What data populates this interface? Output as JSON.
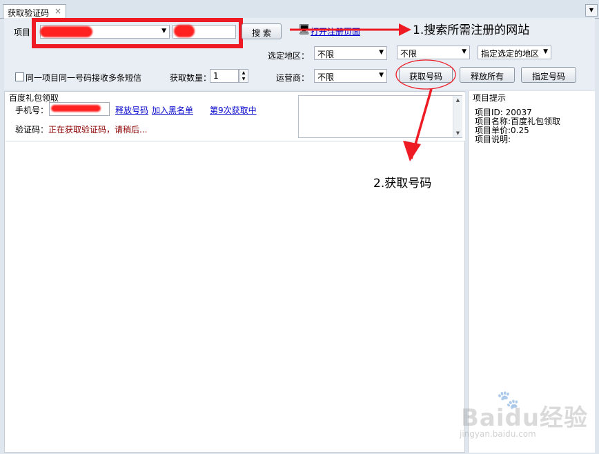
{
  "tab": {
    "title": "获取验证码",
    "close": "×"
  },
  "toolbar": {
    "project_label": "项目",
    "search_button": "搜 索",
    "open_register_link": "打开注册页面",
    "region_label": "选定地区：",
    "region_province": "不限",
    "region_city": "不限",
    "region_specify": "指定选定的地区",
    "same_project_checkbox": "同一项目同一号码接收多条短信",
    "fetch_count_label": "获取数量：",
    "fetch_count_value": "1",
    "carrier_label": "运营商：",
    "carrier_value": "不限",
    "get_number_button": "获取号码",
    "release_all_button": "释放所有",
    "specify_number_button": "指定号码"
  },
  "task": {
    "title": "百度礼包领取",
    "phone_label": "手机号：",
    "release_link": "释放号码",
    "blacklist_link": "加入黑名单",
    "attempt_link": "第9次获取中",
    "code_label": "验证码：",
    "code_status": "正在获取验证码，请稍后..."
  },
  "side": {
    "title": "项目提示",
    "lines": [
      "项目ID: 20037",
      "项目名称:百度礼包领取",
      "项目单价:0.25",
      "项目说明:"
    ]
  },
  "annotations": {
    "step1": "1.搜索所需注册的网站",
    "step2": "2.获取号码"
  },
  "watermark": {
    "brand": "Baidu经验",
    "url": "jingyan.baidu.com"
  },
  "colors": {
    "annotation_red": "#ee1b24",
    "link": "#0000cc",
    "status": "#8b0000"
  }
}
